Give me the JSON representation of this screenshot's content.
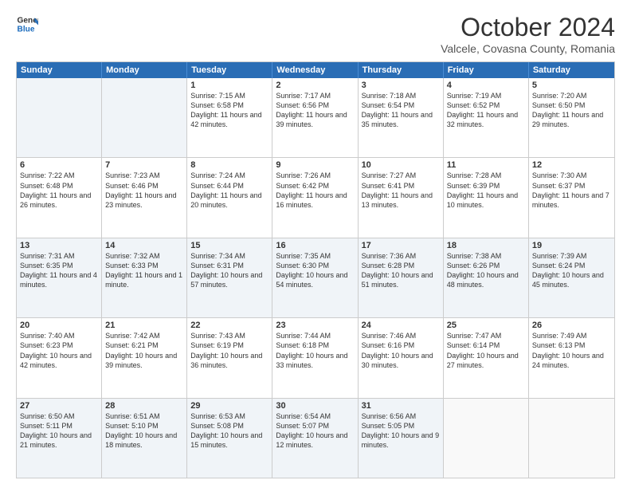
{
  "logo": {
    "line1": "General",
    "line2": "Blue"
  },
  "title": "October 2024",
  "subtitle": "Valcele, Covasna County, Romania",
  "header_days": [
    "Sunday",
    "Monday",
    "Tuesday",
    "Wednesday",
    "Thursday",
    "Friday",
    "Saturday"
  ],
  "weeks": [
    [
      {
        "day": "",
        "sunrise": "",
        "sunset": "",
        "daylight": "",
        "shaded": true
      },
      {
        "day": "",
        "sunrise": "",
        "sunset": "",
        "daylight": "",
        "shaded": true
      },
      {
        "day": "1",
        "sunrise": "Sunrise: 7:15 AM",
        "sunset": "Sunset: 6:58 PM",
        "daylight": "Daylight: 11 hours and 42 minutes.",
        "shaded": false
      },
      {
        "day": "2",
        "sunrise": "Sunrise: 7:17 AM",
        "sunset": "Sunset: 6:56 PM",
        "daylight": "Daylight: 11 hours and 39 minutes.",
        "shaded": false
      },
      {
        "day": "3",
        "sunrise": "Sunrise: 7:18 AM",
        "sunset": "Sunset: 6:54 PM",
        "daylight": "Daylight: 11 hours and 35 minutes.",
        "shaded": false
      },
      {
        "day": "4",
        "sunrise": "Sunrise: 7:19 AM",
        "sunset": "Sunset: 6:52 PM",
        "daylight": "Daylight: 11 hours and 32 minutes.",
        "shaded": false
      },
      {
        "day": "5",
        "sunrise": "Sunrise: 7:20 AM",
        "sunset": "Sunset: 6:50 PM",
        "daylight": "Daylight: 11 hours and 29 minutes.",
        "shaded": false
      }
    ],
    [
      {
        "day": "6",
        "sunrise": "Sunrise: 7:22 AM",
        "sunset": "Sunset: 6:48 PM",
        "daylight": "Daylight: 11 hours and 26 minutes.",
        "shaded": false
      },
      {
        "day": "7",
        "sunrise": "Sunrise: 7:23 AM",
        "sunset": "Sunset: 6:46 PM",
        "daylight": "Daylight: 11 hours and 23 minutes.",
        "shaded": false
      },
      {
        "day": "8",
        "sunrise": "Sunrise: 7:24 AM",
        "sunset": "Sunset: 6:44 PM",
        "daylight": "Daylight: 11 hours and 20 minutes.",
        "shaded": false
      },
      {
        "day": "9",
        "sunrise": "Sunrise: 7:26 AM",
        "sunset": "Sunset: 6:42 PM",
        "daylight": "Daylight: 11 hours and 16 minutes.",
        "shaded": false
      },
      {
        "day": "10",
        "sunrise": "Sunrise: 7:27 AM",
        "sunset": "Sunset: 6:41 PM",
        "daylight": "Daylight: 11 hours and 13 minutes.",
        "shaded": false
      },
      {
        "day": "11",
        "sunrise": "Sunrise: 7:28 AM",
        "sunset": "Sunset: 6:39 PM",
        "daylight": "Daylight: 11 hours and 10 minutes.",
        "shaded": false
      },
      {
        "day": "12",
        "sunrise": "Sunrise: 7:30 AM",
        "sunset": "Sunset: 6:37 PM",
        "daylight": "Daylight: 11 hours and 7 minutes.",
        "shaded": false
      }
    ],
    [
      {
        "day": "13",
        "sunrise": "Sunrise: 7:31 AM",
        "sunset": "Sunset: 6:35 PM",
        "daylight": "Daylight: 11 hours and 4 minutes.",
        "shaded": true
      },
      {
        "day": "14",
        "sunrise": "Sunrise: 7:32 AM",
        "sunset": "Sunset: 6:33 PM",
        "daylight": "Daylight: 11 hours and 1 minute.",
        "shaded": true
      },
      {
        "day": "15",
        "sunrise": "Sunrise: 7:34 AM",
        "sunset": "Sunset: 6:31 PM",
        "daylight": "Daylight: 10 hours and 57 minutes.",
        "shaded": true
      },
      {
        "day": "16",
        "sunrise": "Sunrise: 7:35 AM",
        "sunset": "Sunset: 6:30 PM",
        "daylight": "Daylight: 10 hours and 54 minutes.",
        "shaded": true
      },
      {
        "day": "17",
        "sunrise": "Sunrise: 7:36 AM",
        "sunset": "Sunset: 6:28 PM",
        "daylight": "Daylight: 10 hours and 51 minutes.",
        "shaded": true
      },
      {
        "day": "18",
        "sunrise": "Sunrise: 7:38 AM",
        "sunset": "Sunset: 6:26 PM",
        "daylight": "Daylight: 10 hours and 48 minutes.",
        "shaded": true
      },
      {
        "day": "19",
        "sunrise": "Sunrise: 7:39 AM",
        "sunset": "Sunset: 6:24 PM",
        "daylight": "Daylight: 10 hours and 45 minutes.",
        "shaded": true
      }
    ],
    [
      {
        "day": "20",
        "sunrise": "Sunrise: 7:40 AM",
        "sunset": "Sunset: 6:23 PM",
        "daylight": "Daylight: 10 hours and 42 minutes.",
        "shaded": false
      },
      {
        "day": "21",
        "sunrise": "Sunrise: 7:42 AM",
        "sunset": "Sunset: 6:21 PM",
        "daylight": "Daylight: 10 hours and 39 minutes.",
        "shaded": false
      },
      {
        "day": "22",
        "sunrise": "Sunrise: 7:43 AM",
        "sunset": "Sunset: 6:19 PM",
        "daylight": "Daylight: 10 hours and 36 minutes.",
        "shaded": false
      },
      {
        "day": "23",
        "sunrise": "Sunrise: 7:44 AM",
        "sunset": "Sunset: 6:18 PM",
        "daylight": "Daylight: 10 hours and 33 minutes.",
        "shaded": false
      },
      {
        "day": "24",
        "sunrise": "Sunrise: 7:46 AM",
        "sunset": "Sunset: 6:16 PM",
        "daylight": "Daylight: 10 hours and 30 minutes.",
        "shaded": false
      },
      {
        "day": "25",
        "sunrise": "Sunrise: 7:47 AM",
        "sunset": "Sunset: 6:14 PM",
        "daylight": "Daylight: 10 hours and 27 minutes.",
        "shaded": false
      },
      {
        "day": "26",
        "sunrise": "Sunrise: 7:49 AM",
        "sunset": "Sunset: 6:13 PM",
        "daylight": "Daylight: 10 hours and 24 minutes.",
        "shaded": false
      }
    ],
    [
      {
        "day": "27",
        "sunrise": "Sunrise: 6:50 AM",
        "sunset": "Sunset: 5:11 PM",
        "daylight": "Daylight: 10 hours and 21 minutes.",
        "shaded": true
      },
      {
        "day": "28",
        "sunrise": "Sunrise: 6:51 AM",
        "sunset": "Sunset: 5:10 PM",
        "daylight": "Daylight: 10 hours and 18 minutes.",
        "shaded": true
      },
      {
        "day": "29",
        "sunrise": "Sunrise: 6:53 AM",
        "sunset": "Sunset: 5:08 PM",
        "daylight": "Daylight: 10 hours and 15 minutes.",
        "shaded": true
      },
      {
        "day": "30",
        "sunrise": "Sunrise: 6:54 AM",
        "sunset": "Sunset: 5:07 PM",
        "daylight": "Daylight: 10 hours and 12 minutes.",
        "shaded": true
      },
      {
        "day": "31",
        "sunrise": "Sunrise: 6:56 AM",
        "sunset": "Sunset: 5:05 PM",
        "daylight": "Daylight: 10 hours and 9 minutes.",
        "shaded": true
      },
      {
        "day": "",
        "sunrise": "",
        "sunset": "",
        "daylight": "",
        "shaded": false
      },
      {
        "day": "",
        "sunrise": "",
        "sunset": "",
        "daylight": "",
        "shaded": false
      }
    ]
  ]
}
